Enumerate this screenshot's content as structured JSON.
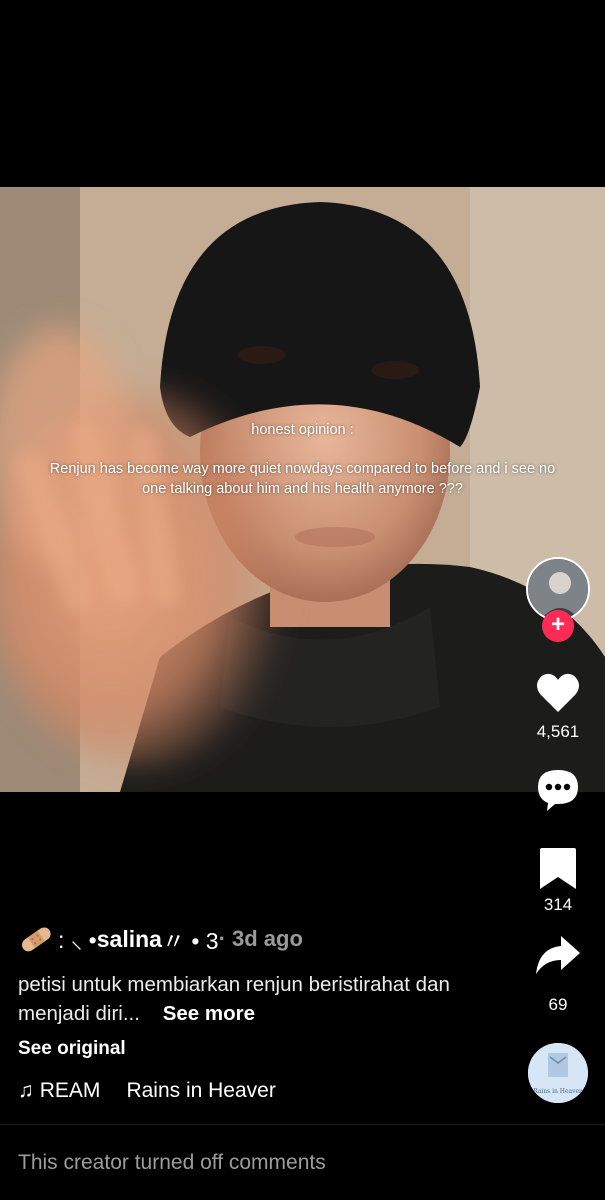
{
  "video": {
    "overlay_heading": "honest opinion :",
    "overlay_body": "Renjun has become way more quiet nowdays compared to before and i see no one talking about him and his health anymore ???"
  },
  "actions": {
    "follow_label": "+",
    "likes": "4,561",
    "bookmarks": "314",
    "shares": "69"
  },
  "post": {
    "author_prefix": " : ⸜ • ",
    "author_name": "salina",
    "author_suffix": " 〃 • 3",
    "posted_ago": " · 3d ago",
    "caption_text": "petisi untuk membiarkan renjun beristirahat dan menjadi diri...",
    "see_more": "See more",
    "see_original": "See original"
  },
  "music": {
    "note_icon": "♫",
    "artist": "REAM",
    "track": "Rains in Heaver",
    "disc_label": "Rains in Heaven"
  },
  "comments": {
    "disabled_text": "This creator turned off comments"
  },
  "colors": {
    "background": "#000000",
    "follow_accent": "#fe2c55",
    "muted_text": "#9c9c9c"
  }
}
